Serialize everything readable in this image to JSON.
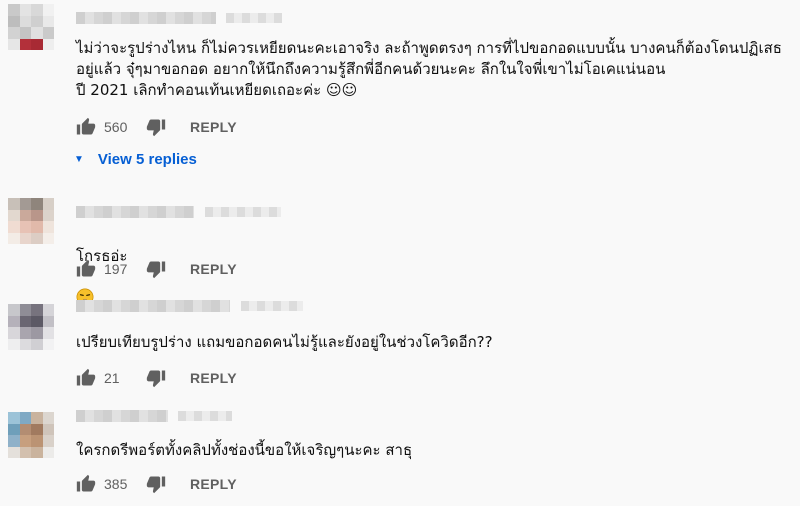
{
  "comments": [
    {
      "text": "ไม่ว่าจะรูปร่างไหน ก็ไม่ควรเหยียดนะคะเอาจริง ละถ้าพูดตรงๆ การที่ไปขอกอดแบบนั้น บางคนก็ต้องโดนปฏิเสธอยู่แล้ว  จุ๋ๆมาขอกอด อยากให้นึกถึงความรู้สึกพี่อีกคนด้วยนะคะ ลึกในใจพี่เขาไม่โอเคแน่นอน\nปี 2021 เลิกทำคอนเท้นเหยียดเถอะค่ะ ☺☺",
      "likes": "560",
      "reply_label": "REPLY",
      "view_replies": "View 5 replies",
      "avatar_colors": [
        "#c9c9c9",
        "#e3e3e3",
        "#d8d8d8",
        "#f1f1f1",
        "#bdbdbd",
        "#dcdcdc",
        "#cfcfcf",
        "#e9e9e9",
        "#d2d2d2",
        "#c4c4c4",
        "#e0e0e0",
        "#cacaca",
        "#e6e6e6",
        "#b3303a",
        "#a82a34",
        "#eeeeee"
      ]
    },
    {
      "text": "โกรธอ่ะ",
      "emoji": "weary-face",
      "likes": "197",
      "reply_label": "REPLY",
      "avatar_colors": [
        "#c8c0b8",
        "#a39a94",
        "#8f857c",
        "#d7cfc7",
        "#e2d8cf",
        "#caa99b",
        "#b9968a",
        "#dcd3cb",
        "#f0dcd2",
        "#e7c2b5",
        "#e1b9aa",
        "#efe4dc",
        "#f3ece6",
        "#e8d5cc",
        "#dccdc4",
        "#f4eee9"
      ]
    },
    {
      "text": "เปรียบเทียบรูปร่าง แถมขอกอดคนไม่รู้และยังอยู่ในช่วงโควิดอีก??",
      "likes": "21",
      "reply_label": "REPLY",
      "avatar_colors": [
        "#c7c7cb",
        "#8f8d96",
        "#77737e",
        "#d5d4d8",
        "#b5b1ba",
        "#6a6672",
        "#5c5965",
        "#c2c0c6",
        "#d8d6da",
        "#a9a5ae",
        "#9c98a2",
        "#e2e1e4",
        "#eeeeef",
        "#dcdbde",
        "#d0cfd3",
        "#f2f2f3"
      ]
    },
    {
      "text": "ใครกดรีพอร์ตทั้งคลิปทั้งช่องนี้ขอให้เจริญๆนะคะ สาธุ",
      "likes": "385",
      "reply_label": "REPLY",
      "avatar_colors": [
        "#9cc3d8",
        "#7fa9c4",
        "#c9b39e",
        "#dcd6cf",
        "#6f9fba",
        "#b38d72",
        "#a17a5f",
        "#cfc4ba",
        "#8fb1c9",
        "#c79f7e",
        "#bb9373",
        "#d9d1c9",
        "#e4e0db",
        "#d3c0ae",
        "#cab39d",
        "#ecebe9"
      ]
    }
  ]
}
